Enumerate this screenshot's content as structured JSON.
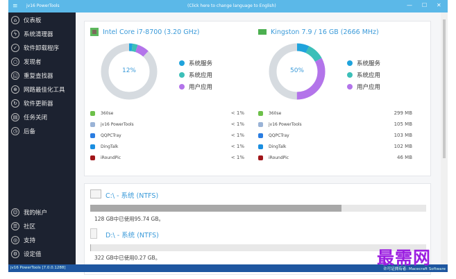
{
  "titlebar": {
    "app_name": "jv16 PowerTools",
    "language_link": "(Click here to change language to English)",
    "minimize": "—",
    "maximize": "☐",
    "close": "✕"
  },
  "sidebar": {
    "items": [
      {
        "label": "仪表板",
        "icon": "home-icon",
        "glyph": "⌂"
      },
      {
        "label": "系统清理器",
        "icon": "lightning-icon",
        "glyph": "ϟ"
      },
      {
        "label": "软件卸载程序",
        "icon": "check-circle-icon",
        "glyph": "✓"
      },
      {
        "label": "发现者",
        "icon": "search-icon",
        "glyph": "○"
      },
      {
        "label": "重复查找器",
        "icon": "duplicate-search-icon",
        "glyph": "◱"
      },
      {
        "label": "网路最佳化工具",
        "icon": "globe-icon",
        "glyph": "⊕"
      },
      {
        "label": "软件更新器",
        "icon": "refresh-icon",
        "glyph": "↻"
      },
      {
        "label": "任务关闭",
        "icon": "task-icon",
        "glyph": "▤"
      },
      {
        "label": "后备",
        "icon": "clock-icon",
        "glyph": "◷"
      }
    ],
    "bottom_items": [
      {
        "label": "我的帐户",
        "icon": "account-icon",
        "glyph": "☺"
      },
      {
        "label": "社区",
        "icon": "community-icon",
        "glyph": "☰"
      },
      {
        "label": "支持",
        "icon": "support-icon",
        "glyph": "◎"
      },
      {
        "label": "设定值",
        "icon": "settings-icon",
        "glyph": "⚙"
      }
    ]
  },
  "cpu": {
    "title": "Intel Core i7-8700 (3.20 GHz)",
    "percent": "12%",
    "usage": {
      "system_services": 2,
      "system_apps": 3,
      "user_apps": 7
    },
    "processes": [
      {
        "name": "360se",
        "value": "< 1%",
        "color": "#6dc04a"
      },
      {
        "name": "jv16 PowerTools",
        "value": "< 1%",
        "color": "#9ab3d6"
      },
      {
        "name": "QQPCTray",
        "value": "< 1%",
        "color": "#2a7de1"
      },
      {
        "name": "DingTalk",
        "value": "< 1%",
        "color": "#1a8ee0"
      },
      {
        "name": "iRoundPic",
        "value": "< 1%",
        "color": "#a0161a"
      }
    ]
  },
  "ram": {
    "title": "Kingston 7.9 / 16 GB (2666 MHz)",
    "percent": "50%",
    "usage": {
      "system_services": 7,
      "system_apps": 10,
      "user_apps": 33
    },
    "processes": [
      {
        "name": "360se",
        "value": "299 MB",
        "color": "#6dc04a"
      },
      {
        "name": "jv16 PowerTools",
        "value": "105 MB",
        "color": "#9ab3d6"
      },
      {
        "name": "QQPCTray",
        "value": "103 MB",
        "color": "#2a7de1"
      },
      {
        "name": "DingTalk",
        "value": "102 MB",
        "color": "#1a8ee0"
      },
      {
        "name": "iRoundPic",
        "value": "46 MB",
        "color": "#a0161a"
      }
    ]
  },
  "legend": {
    "system_services": "系统服务",
    "system_apps": "系统应用",
    "user_apps": "用户应用"
  },
  "colors": {
    "system_services": "#1fa3dc",
    "system_apps": "#3cbfb8",
    "user_apps": "#b374ea",
    "ring": "#d6dbe0"
  },
  "drives": [
    {
      "title": "C:\\ - 系统 (NTFS)",
      "used_percent": 74.8,
      "text": "128 GB中已使用95.74 GB。"
    },
    {
      "title": "D:\\ - 系统 (NTFS)",
      "used_percent": 0.1,
      "text": "322 GB中已使用0.27 GB。"
    }
  ],
  "status": {
    "version": "jv16 PowerTools [7.0.0.1288]",
    "license": "许可证拥有者: Macecraft Software"
  },
  "watermark": "最需网"
}
